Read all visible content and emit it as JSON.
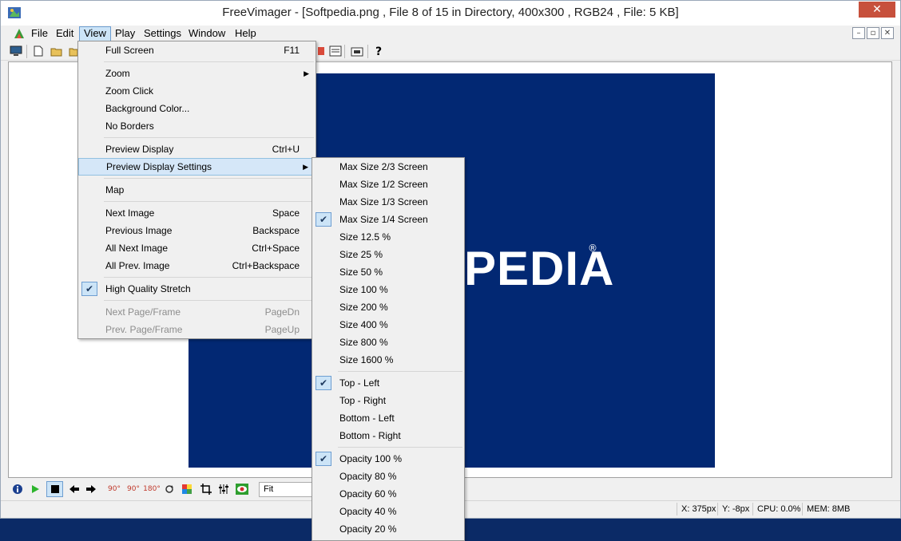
{
  "window": {
    "title": "FreeVimager - [Softpedia.png , File 8 of 15 in Directory, 400x300 , RGB24 , File: 5 KB]",
    "close_glyph": "✕"
  },
  "menubar": {
    "items": [
      "File",
      "Edit",
      "View",
      "Play",
      "Settings",
      "Window",
      "Help"
    ],
    "open_menu": "View",
    "mdi_buttons": [
      "–",
      "▫",
      "✕"
    ]
  },
  "view_menu": {
    "items": [
      {
        "label": "Full Screen",
        "shortcut": "F11"
      },
      {
        "label": "Zoom",
        "submenu": true
      },
      {
        "label": "Zoom Click"
      },
      {
        "label": "Background Color..."
      },
      {
        "label": "No Borders"
      },
      {
        "label": "Preview Display",
        "shortcut": "Ctrl+U"
      },
      {
        "label": "Preview Display Settings",
        "submenu": true,
        "highlighted": true
      },
      {
        "label": "Map"
      },
      {
        "label": "Next Image",
        "shortcut": "Space"
      },
      {
        "label": "Previous Image",
        "shortcut": "Backspace"
      },
      {
        "label": "All Next Image",
        "shortcut": "Ctrl+Space"
      },
      {
        "label": "All Prev. Image",
        "shortcut": "Ctrl+Backspace"
      },
      {
        "label": "High Quality Stretch",
        "checked": true
      },
      {
        "label": "Next Page/Frame",
        "shortcut": "PageDn",
        "disabled": true
      },
      {
        "label": "Prev. Page/Frame",
        "shortcut": "PageUp",
        "disabled": true
      }
    ]
  },
  "preview_submenu": {
    "items": [
      {
        "label": "Max Size 2/3 Screen"
      },
      {
        "label": "Max Size 1/2 Screen"
      },
      {
        "label": "Max Size 1/3 Screen"
      },
      {
        "label": "Max Size 1/4 Screen",
        "checked": true
      },
      {
        "label": "Size 12.5 %"
      },
      {
        "label": "Size 25 %"
      },
      {
        "label": "Size 50 %"
      },
      {
        "label": "Size 100 %"
      },
      {
        "label": "Size 200 %"
      },
      {
        "label": "Size 400 %"
      },
      {
        "label": "Size 800 %"
      },
      {
        "label": "Size 1600 %"
      },
      {
        "label": "Top - Left",
        "checked": true
      },
      {
        "label": "Top - Right"
      },
      {
        "label": "Bottom - Left"
      },
      {
        "label": "Bottom - Right"
      },
      {
        "label": "Opacity 100 %",
        "checked": true
      },
      {
        "label": "Opacity 80 %"
      },
      {
        "label": "Opacity 60 %"
      },
      {
        "label": "Opacity 40 %"
      },
      {
        "label": "Opacity 20 %"
      }
    ]
  },
  "image": {
    "logo_text": "PEDIA",
    "logo_reg": "®",
    "background_color": "#022873"
  },
  "bottombar": {
    "zoom_value": "Fit",
    "rotate_labels": [
      "90°",
      "90°",
      "180°"
    ]
  },
  "statusbar": {
    "x": "X: 375px",
    "y": "Y: -8px",
    "cpu": "CPU: 0.0%",
    "mem": "MEM: 8MB"
  },
  "colors": {
    "accent": "#cce4f7",
    "accent_border": "#6e9ed1",
    "close": "#c7503c",
    "taskbar": "#0b2a66"
  }
}
